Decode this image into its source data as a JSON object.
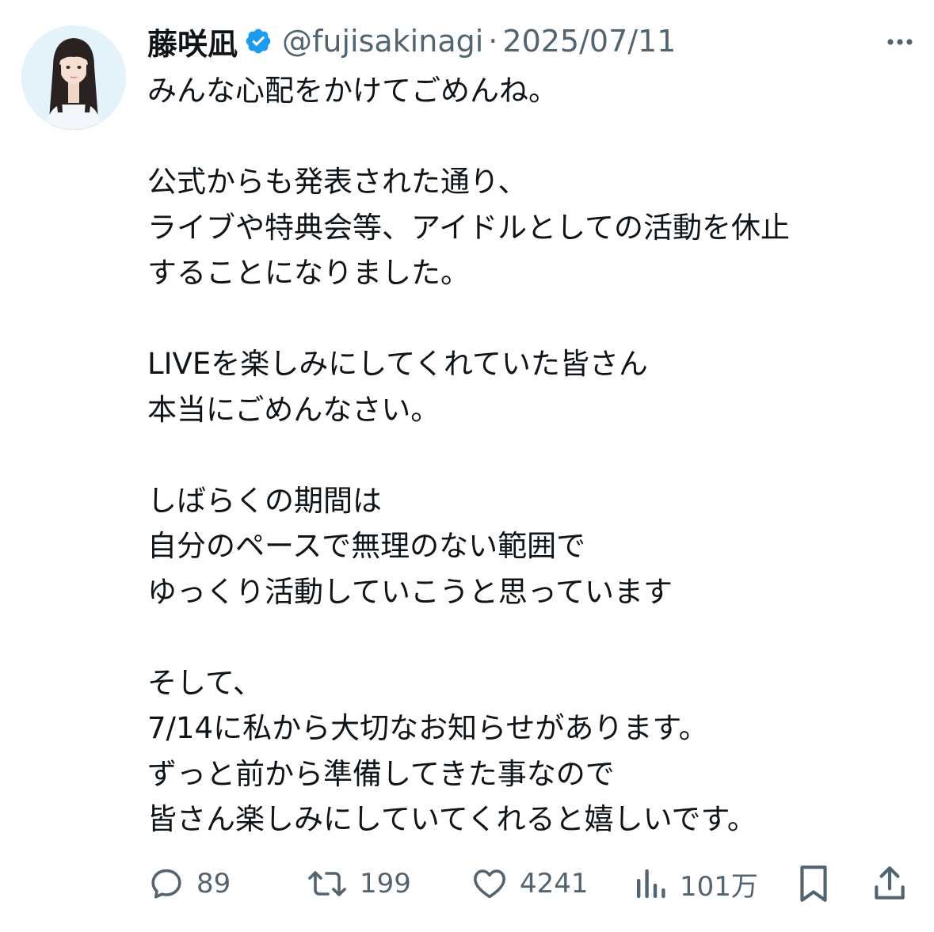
{
  "author": {
    "display_name": "藤咲凪",
    "verified": true,
    "handle": "@fujisakinagi",
    "separator": "·",
    "date": "2025/07/11"
  },
  "tweet": {
    "lines": [
      "みんな心配をかけてごめんね。",
      "",
      "公式からも発表された通り、",
      "ライブや特典会等、アイドルとしての活動を休止",
      "することになりました。",
      "",
      "LIVEを楽しみにしてくれていた皆さん",
      "本当にごめんなさい。",
      "",
      "しばらくの期間は",
      "自分のペースで無理のない範囲で",
      "ゆっくり活動していこうと思っています",
      "",
      "そして、",
      "7/14に私から大切なお知らせがあります。",
      "ずっと前から準備してきた事なので",
      "皆さん楽しみにしていてくれると嬉しいです。"
    ]
  },
  "actions": {
    "replies": "89",
    "reposts": "199",
    "likes": "4241",
    "views": "101万"
  },
  "icons": {
    "verified": "verified-badge-icon",
    "more": "more-dots-icon",
    "reply": "reply-bubble-icon",
    "repost": "repost-arrows-icon",
    "like": "heart-icon",
    "views": "bar-chart-icon",
    "bookmark": "bookmark-icon",
    "share": "share-upload-icon"
  },
  "colors": {
    "text": "#0f1419",
    "secondary": "#536471",
    "verified": "#1d9bf0"
  }
}
